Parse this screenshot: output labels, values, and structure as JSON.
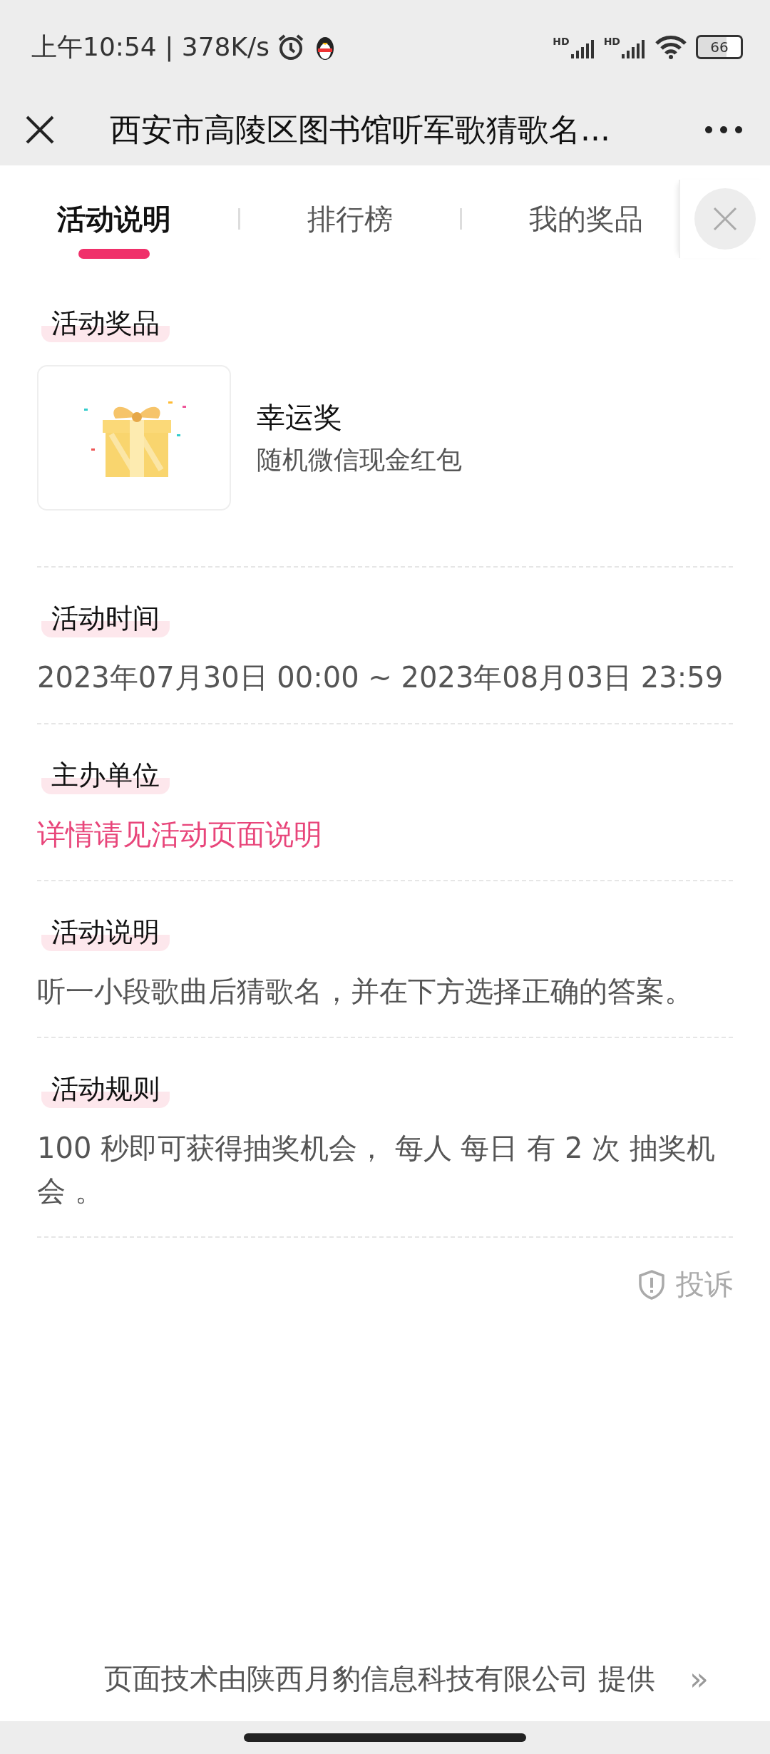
{
  "status_bar": {
    "time": "上午10:54 | 378K/s",
    "signals": [
      "HD",
      "HD"
    ],
    "battery": "66"
  },
  "title_bar": {
    "title": "西安市高陵区图书馆听军歌猜歌名..."
  },
  "tabs": [
    {
      "label": "活动说明",
      "selected": true
    },
    {
      "label": "排行榜",
      "selected": false
    },
    {
      "label": "我的奖品",
      "selected": false
    }
  ],
  "sections": [
    {
      "heading": "活动奖品",
      "kind": "prize",
      "prize": {
        "name": "幸运奖",
        "description": "随机微信现金红包"
      }
    },
    {
      "heading": "活动时间",
      "kind": "text",
      "text": "2023年07月30日 00:00 ~ 2023年08月03日 23:59"
    },
    {
      "heading": "主办单位",
      "kind": "link",
      "text": "详情请见活动页面说明"
    },
    {
      "heading": "活动说明",
      "kind": "text",
      "text": "听一小段歌曲后猜歌名，并在下方选择正确的答案。"
    },
    {
      "heading": "活动规则",
      "kind": "text",
      "text": "100 秒即可获得抽奖机会， 每人 每日 有 2 次 抽奖机会 。"
    }
  ],
  "report": "投诉",
  "footer": {
    "text": "页面技术由陕西月豹信息科技有限公司 提供",
    "arrow": "»"
  }
}
